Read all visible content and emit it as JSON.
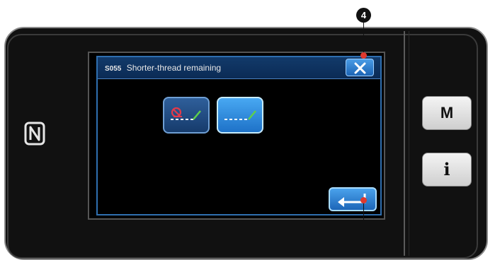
{
  "callout_number": "4",
  "dialog": {
    "code": "S055",
    "title": "Shorter-thread remaining"
  },
  "side_keys": {
    "mode": "M",
    "info": "i"
  },
  "icons": {
    "close": "close-icon",
    "option_off": "thread-trim-off-icon",
    "option_on": "short-thread-icon",
    "enter": "enter-icon",
    "nfc": "nfc-icon"
  },
  "colors": {
    "accent_blue": "#1e72c8",
    "callout_dot": "#e0392e",
    "check_green": "#5fd04a",
    "prohibit_red": "#e23a4a"
  }
}
